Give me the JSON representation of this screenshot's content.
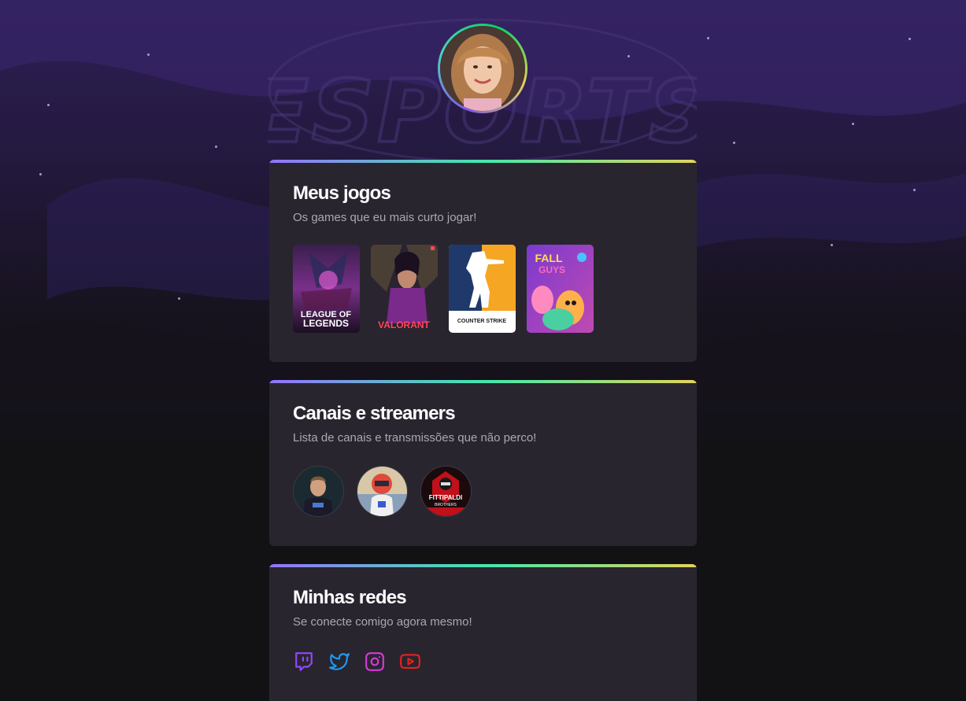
{
  "profile": {
    "avatar_icon": "profile-photo"
  },
  "background": {
    "watermark_text": "ESPORTS"
  },
  "games_card": {
    "title": "Meus jogos",
    "subtitle": "Os games que eu mais curto jogar!",
    "games": [
      {
        "name": "league-of-legends",
        "label_line1": "LEAGUE OF",
        "label_line2": "LEGENDS"
      },
      {
        "name": "valorant",
        "label": "VALORANT"
      },
      {
        "name": "counter-strike",
        "label": "COUNTER STRIKE"
      },
      {
        "name": "fall-guys",
        "label_line1": "FALL",
        "label_line2": "GUYS"
      }
    ]
  },
  "channels_card": {
    "title": "Canais e streamers",
    "subtitle": "Lista de canais e transmissões que não perco!",
    "channels": [
      {
        "name": "channel-1"
      },
      {
        "name": "channel-2"
      },
      {
        "name": "channel-3",
        "label_line1": "FITTIPALDI",
        "label_line2": "BROTHERS"
      }
    ]
  },
  "social_card": {
    "title": "Minhas redes",
    "subtitle": "Se conecte comigo agora mesmo!",
    "networks": [
      {
        "name": "twitch",
        "color": "#9146ff"
      },
      {
        "name": "twitter",
        "color": "#1d9bf0"
      },
      {
        "name": "instagram",
        "color": "#d53ad6"
      },
      {
        "name": "youtube",
        "color": "#e1231f"
      }
    ]
  },
  "colors": {
    "card_bg": "#29252f",
    "accent_gradient_start": "#9572fc",
    "accent_gradient_mid": "#43e7ad",
    "accent_gradient_end": "#e2d45c"
  }
}
